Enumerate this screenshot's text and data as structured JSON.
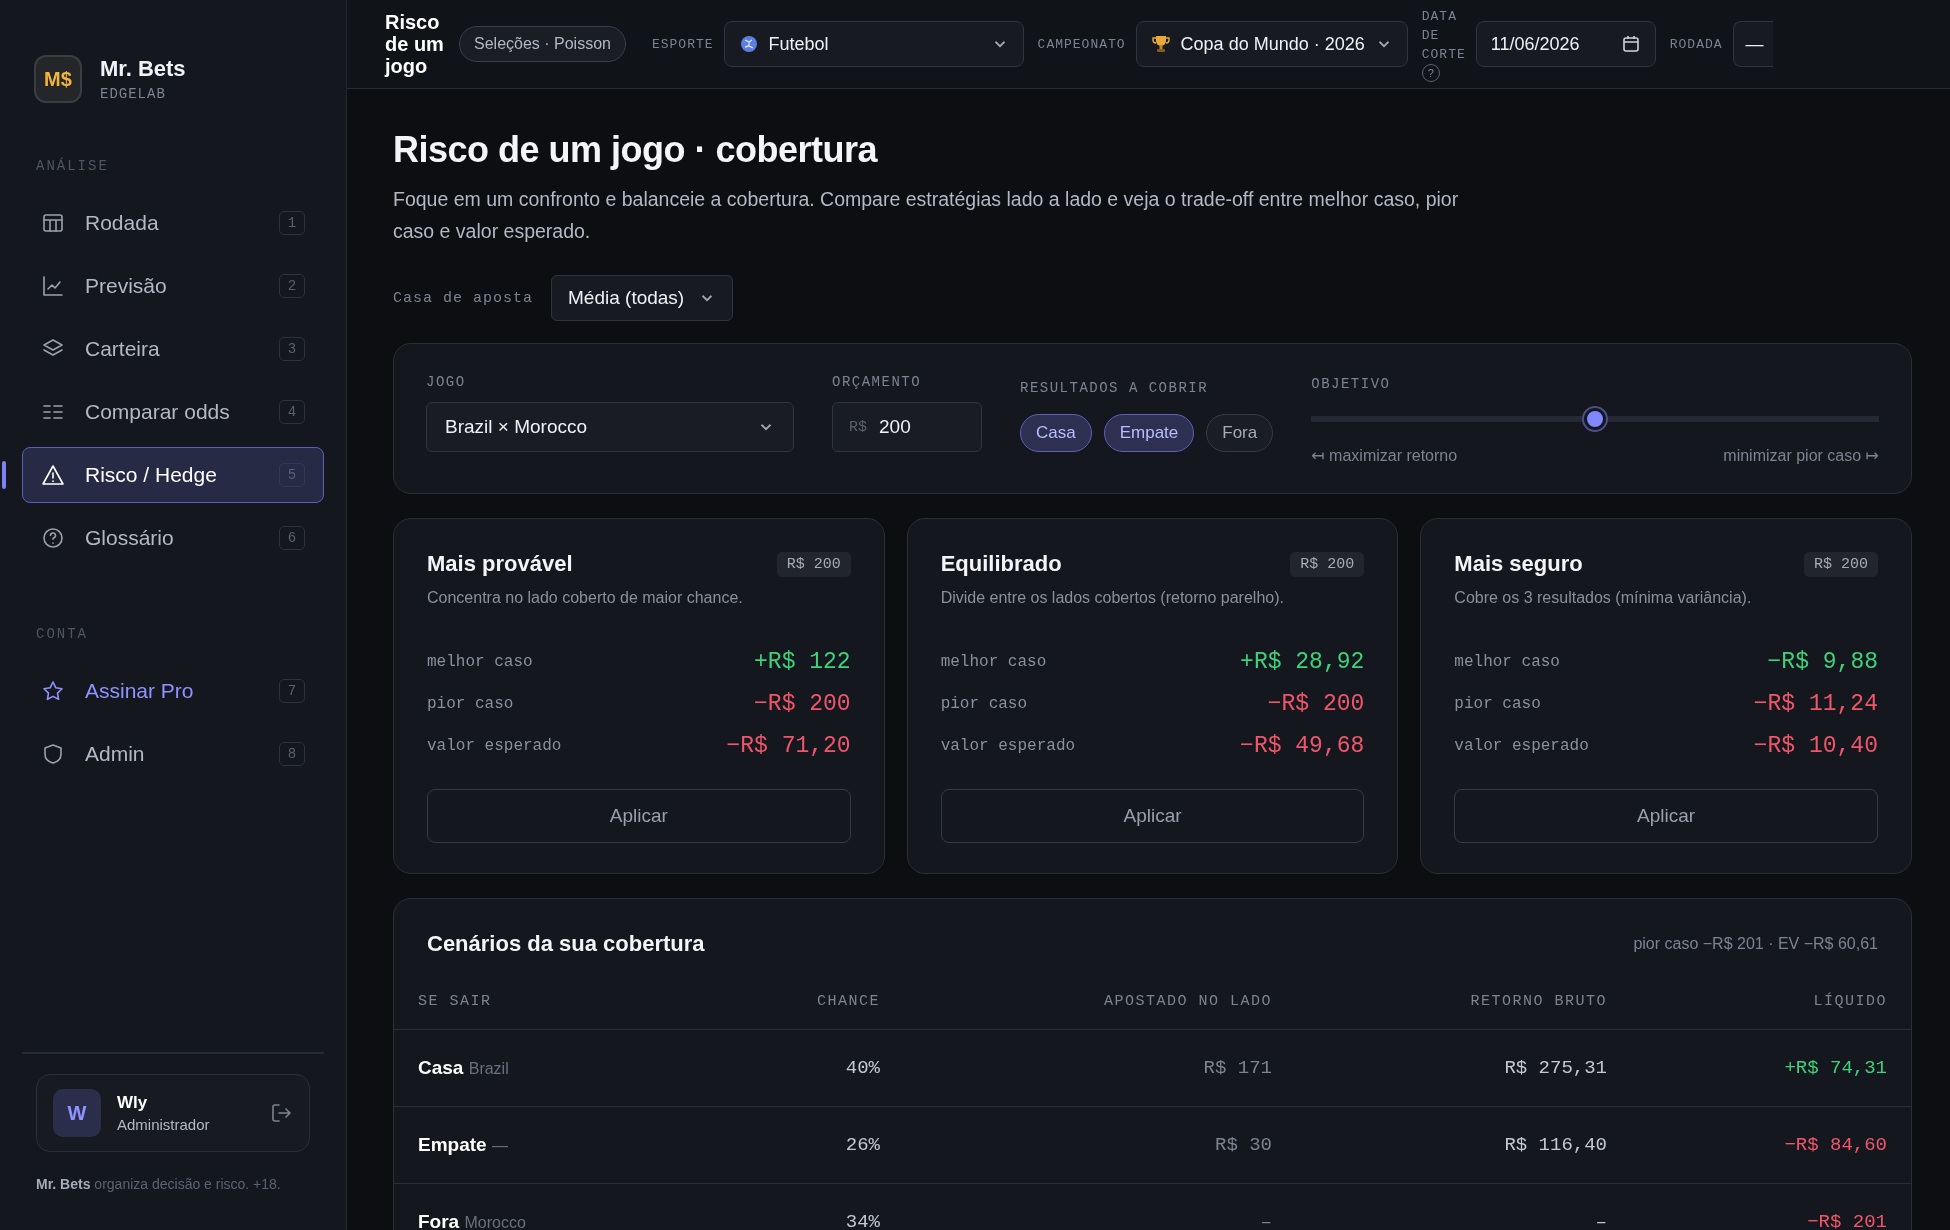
{
  "brand": {
    "logo": "M$",
    "name": "Mr. Bets",
    "subtitle": "EDGELAB"
  },
  "sidebar": {
    "sections": [
      {
        "title": "ANÁLISE",
        "items": [
          {
            "label": "Rodada",
            "kind": "table",
            "shortcut": "1",
            "selected": false,
            "highlight": false
          },
          {
            "label": "Previsão",
            "kind": "chart",
            "shortcut": "2",
            "selected": false,
            "highlight": false
          },
          {
            "label": "Carteira",
            "kind": "layers",
            "shortcut": "3",
            "selected": false,
            "highlight": false
          },
          {
            "label": "Comparar odds",
            "kind": "list",
            "shortcut": "4",
            "selected": false,
            "highlight": false
          },
          {
            "label": "Risco / Hedge",
            "kind": "warning",
            "shortcut": "5",
            "selected": true,
            "highlight": false
          },
          {
            "label": "Glossário",
            "kind": "help",
            "shortcut": "6",
            "selected": false,
            "highlight": false
          }
        ]
      },
      {
        "title": "CONTA",
        "items": [
          {
            "label": "Assinar Pro",
            "kind": "star",
            "shortcut": "7",
            "selected": false,
            "highlight": true
          },
          {
            "label": "Admin",
            "kind": "shield",
            "shortcut": "8",
            "selected": false,
            "highlight": false
          }
        ]
      }
    ],
    "user": {
      "initial": "W",
      "name": "Wly",
      "role": "Administrador"
    },
    "footer": "**Mr. Bets** organiza decisão e risco. +18."
  },
  "topbar": {
    "title": "Risco de um jogo",
    "model": "Seleções · Poisson",
    "filters": [
      {
        "label": "ESPORTE",
        "kind": "select",
        "value": "Futebol"
      },
      {
        "label": "CAMPEONATO",
        "kind": "select",
        "value": "Copa do Mundo · 2026"
      },
      {
        "label": "DATA DE CORTE",
        "kind": "date",
        "help": "?",
        "value": "11/06/2026"
      },
      {
        "label": "RODADA",
        "kind": "select-cut",
        "value": "—"
      }
    ]
  },
  "page": {
    "title": "Risco de um jogo · cobertura",
    "description": "Foque em um confronto e balanceie a cobertura. Compare estratégias lado a lado e veja o trade-off entre melhor caso, pior caso e valor esperado.",
    "bookmaker": {
      "label": "Casa de aposta",
      "value": "Média (todas)"
    }
  },
  "controls": {
    "game": {
      "label": "JOGO",
      "value": "Brazil × Morocco"
    },
    "budget": {
      "label": "ORÇAMENTO",
      "prefix": "R$",
      "value": "200"
    },
    "outcomes": {
      "label": "RESULTADOS A COBRIR",
      "chips": [
        {
          "label": "Casa",
          "selected": true
        },
        {
          "label": "Empate",
          "selected": true
        },
        {
          "label": "Fora",
          "selected": false
        }
      ]
    },
    "objective": {
      "label": "OBJETIVO",
      "level": 0.5,
      "left": "↤ maximizar retorno",
      "right": "minimizar pior caso ↦"
    }
  },
  "strategies": [
    {
      "title": "Mais provável",
      "stake": "R$ 200",
      "description": "Concentra no lado coberto de maior chance.",
      "metrics": [
        {
          "label": "melhor caso",
          "value": "+R$ 122",
          "color": "#3fd27a"
        },
        {
          "label": "pior caso",
          "value": "−R$ 200",
          "color": "#f0566a"
        },
        {
          "label": "valor esperado",
          "value": "−R$ 71,20",
          "color": "#f0566a"
        }
      ],
      "action": "Aplicar"
    },
    {
      "title": "Equilibrado",
      "stake": "R$ 200",
      "description": "Divide entre os lados cobertos (retorno parelho).",
      "metrics": [
        {
          "label": "melhor caso",
          "value": "+R$ 28,92",
          "color": "#3fd27a"
        },
        {
          "label": "pior caso",
          "value": "−R$ 200",
          "color": "#f0566a"
        },
        {
          "label": "valor esperado",
          "value": "−R$ 49,68",
          "color": "#f0566a"
        }
      ],
      "action": "Aplicar"
    },
    {
      "title": "Mais seguro",
      "stake": "R$ 200",
      "description": "Cobre os 3 resultados (mínima variância).",
      "metrics": [
        {
          "label": "melhor caso",
          "value": "−R$ 9,88",
          "color": "#3fd27a"
        },
        {
          "label": "pior caso",
          "value": "−R$ 11,24",
          "color": "#f0566a"
        },
        {
          "label": "valor esperado",
          "value": "−R$ 10,40",
          "color": "#f0566a"
        }
      ],
      "action": "Aplicar"
    }
  ],
  "scenarios": {
    "title": "Cenários da sua cobertura",
    "summary": "pior caso −R$ 201 · EV −R$ 60,61",
    "columns": [
      "SE SAIR",
      "CHANCE",
      "APOSTADO NO LADO",
      "RETORNO BRUTO",
      "LÍQUIDO"
    ],
    "rows": [
      {
        "outcome": "Casa",
        "team": "Brazil",
        "chance": "40%",
        "staked": "R$ 171",
        "gross": "R$ 275,31",
        "net": "+R$ 74,31",
        "color": "#3fd27a"
      },
      {
        "outcome": "Empate",
        "team": "—",
        "chance": "26%",
        "staked": "R$ 30",
        "gross": "R$ 116,40",
        "net": "−R$ 84,60",
        "color": "#f0566a"
      },
      {
        "outcome": "Fora",
        "team": "Morocco",
        "chance": "34%",
        "staked": "–",
        "gross": "–",
        "net": "−R$ 201",
        "color": "#f0566a"
      }
    ]
  }
}
